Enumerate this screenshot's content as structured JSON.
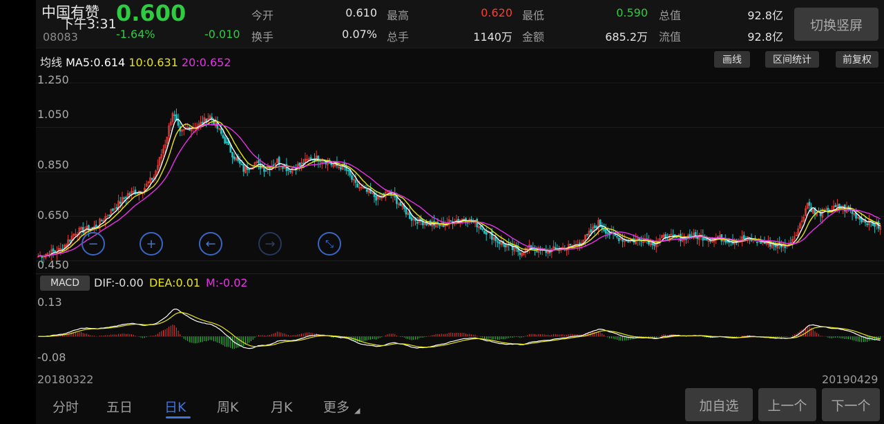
{
  "stock": {
    "name": "中国有赞",
    "time": "下午3:31",
    "code": "08083",
    "price": "0.600",
    "change_pct": "-1.64%",
    "change": "-0.010"
  },
  "quote": {
    "open_label": "今开",
    "open": "0.610",
    "high_label": "最高",
    "high": "0.620",
    "low_label": "最低",
    "low": "0.590",
    "total_cap_label": "总值",
    "total_cap": "92.8亿",
    "turnover_label": "换手",
    "turnover": "0.07%",
    "volume_label": "总手",
    "volume": "1140万",
    "amount_label": "金额",
    "amount": "685.2万",
    "float_cap_label": "流值",
    "float_cap": "92.8亿"
  },
  "switch_button": "切换竖屏",
  "ma": {
    "label": "均线",
    "ma5": "MA5:0.614",
    "ma10": "10:0.631",
    "ma20": "20:0.652",
    "colors": {
      "ma5": "#ffffff",
      "ma10": "#e6e619",
      "ma20": "#e633e6"
    }
  },
  "tools": {
    "draw": "画线",
    "interval": "区间统计",
    "adjust": "前复权"
  },
  "nav_icons": [
    "zoom-out-icon",
    "zoom-in-icon",
    "arrow-left-icon",
    "arrow-right-icon",
    "collapse-icon"
  ],
  "macd": {
    "button": "MACD",
    "dif": "DIF:-0.00",
    "dea": "DEA:0.01",
    "m": "M:-0.02"
  },
  "dates": {
    "start": "20180322",
    "end": "20190429"
  },
  "tabs": [
    "分时",
    "五日",
    "日K",
    "周K",
    "月K",
    "更多"
  ],
  "active_tab": "日K",
  "buttons": {
    "add": "加自选",
    "prev": "上一个",
    "next": "下一个"
  },
  "colors": {
    "up": "#ff3b30",
    "down": "#2ecc40",
    "candle_up": "#e53935",
    "candle_down": "#1fc2c2",
    "accent": "#3f74d8"
  },
  "chart_data": [
    {
      "type": "candlestick",
      "title": "",
      "y_tick_labels": [
        "1.250",
        "1.050",
        "0.850",
        "0.650",
        "0.450"
      ],
      "ylim": [
        0.43,
        1.3
      ],
      "x": {
        "start": "20180322",
        "end": "20190429"
      },
      "close_keypoints": [
        [
          0,
          0.47
        ],
        [
          12,
          0.5
        ],
        [
          20,
          0.58
        ],
        [
          30,
          0.6
        ],
        [
          40,
          0.68
        ],
        [
          48,
          0.75
        ],
        [
          56,
          0.77
        ],
        [
          62,
          0.83
        ],
        [
          68,
          0.98
        ],
        [
          72,
          1.12
        ],
        [
          76,
          1.02
        ],
        [
          80,
          1.05
        ],
        [
          86,
          1.06
        ],
        [
          92,
          1.1
        ],
        [
          98,
          1.02
        ],
        [
          104,
          0.93
        ],
        [
          110,
          0.86
        ],
        [
          116,
          0.89
        ],
        [
          122,
          0.86
        ],
        [
          128,
          0.9
        ],
        [
          134,
          0.86
        ],
        [
          140,
          0.88
        ],
        [
          146,
          0.91
        ],
        [
          152,
          0.91
        ],
        [
          158,
          0.88
        ],
        [
          164,
          0.87
        ],
        [
          170,
          0.79
        ],
        [
          176,
          0.76
        ],
        [
          182,
          0.73
        ],
        [
          188,
          0.76
        ],
        [
          194,
          0.7
        ],
        [
          200,
          0.64
        ],
        [
          208,
          0.62
        ],
        [
          216,
          0.61
        ],
        [
          222,
          0.63
        ],
        [
          228,
          0.64
        ],
        [
          234,
          0.62
        ],
        [
          240,
          0.58
        ],
        [
          246,
          0.54
        ],
        [
          252,
          0.51
        ],
        [
          258,
          0.49
        ],
        [
          264,
          0.51
        ],
        [
          270,
          0.49
        ],
        [
          276,
          0.5
        ],
        [
          282,
          0.51
        ],
        [
          288,
          0.52
        ],
        [
          294,
          0.56
        ],
        [
          300,
          0.62
        ],
        [
          306,
          0.57
        ],
        [
          312,
          0.55
        ],
        [
          318,
          0.54
        ],
        [
          324,
          0.55
        ],
        [
          330,
          0.53
        ],
        [
          336,
          0.56
        ],
        [
          342,
          0.55
        ],
        [
          348,
          0.56
        ],
        [
          354,
          0.56
        ],
        [
          360,
          0.55
        ],
        [
          366,
          0.55
        ],
        [
          372,
          0.54
        ],
        [
          378,
          0.55
        ],
        [
          384,
          0.54
        ],
        [
          390,
          0.53
        ],
        [
          396,
          0.52
        ],
        [
          402,
          0.52
        ],
        [
          408,
          0.61
        ],
        [
          412,
          0.71
        ],
        [
          416,
          0.66
        ],
        [
          422,
          0.67
        ],
        [
          428,
          0.69
        ],
        [
          434,
          0.68
        ],
        [
          440,
          0.64
        ],
        [
          446,
          0.62
        ],
        [
          451,
          0.6
        ]
      ],
      "ma_series": [
        {
          "name": "MA5",
          "last": 0.614
        },
        {
          "name": "10",
          "last": 0.631
        },
        {
          "name": "20",
          "last": 0.652
        }
      ]
    },
    {
      "type": "macd",
      "y_tick_labels": [
        "0.13",
        "-0.08"
      ],
      "ylim": [
        -0.09,
        0.14
      ],
      "dif_last": -0.0,
      "dea_last": 0.01,
      "m_last": -0.02
    }
  ]
}
